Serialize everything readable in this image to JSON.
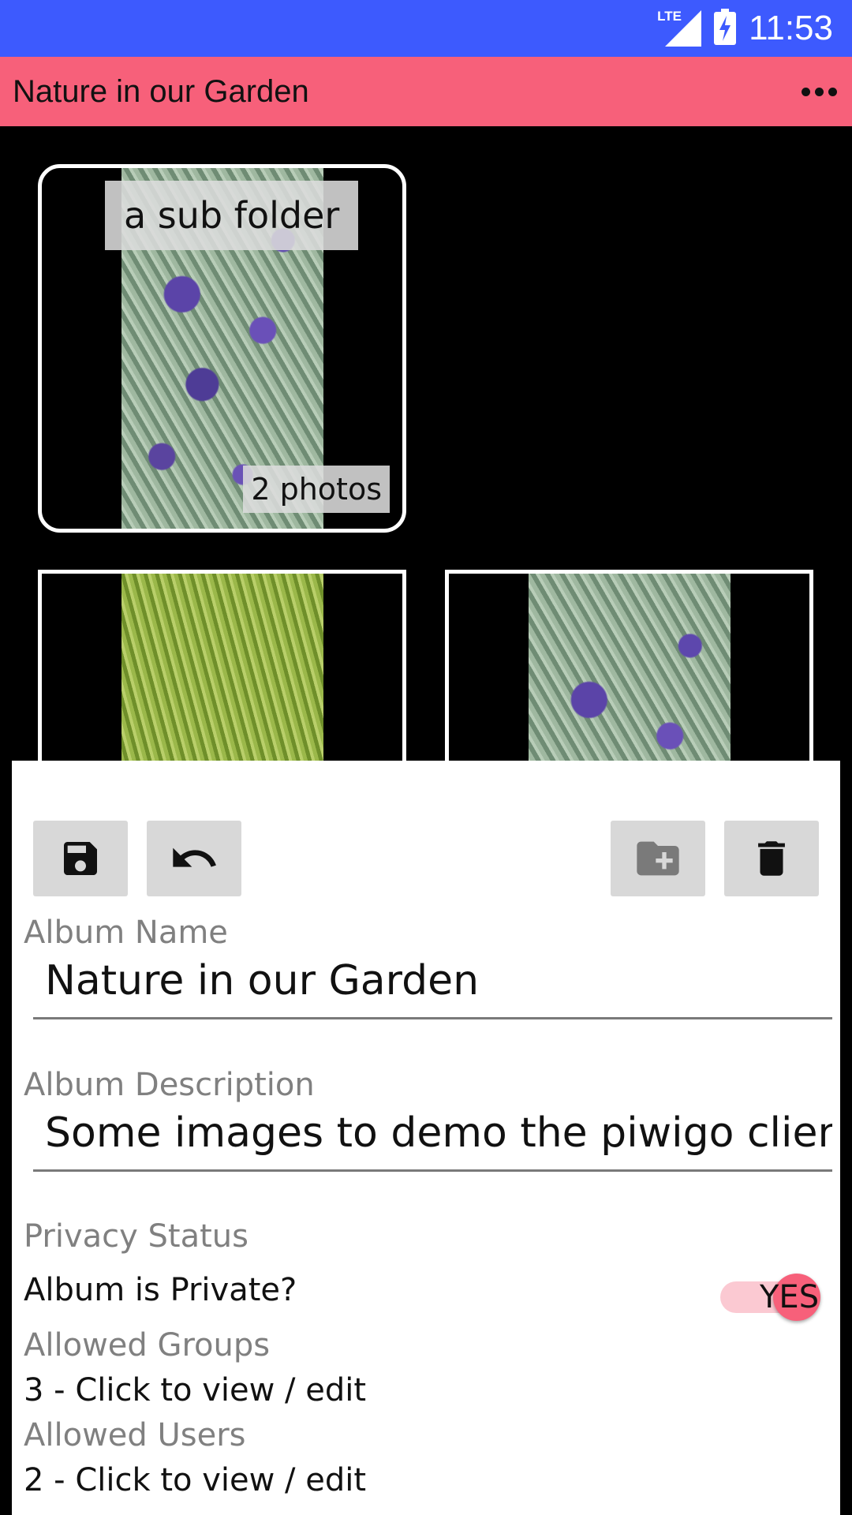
{
  "status_bar": {
    "network": "LTE",
    "time": "11:53",
    "icons": [
      "lte-signal-icon",
      "battery-charging-icon"
    ]
  },
  "toolbar": {
    "title": "Nature in our Garden",
    "overflow_icon": "more-dots-icon"
  },
  "album_grid": {
    "folder": {
      "name": "a sub folder",
      "count": "2 photos"
    },
    "photos": [
      {
        "subject": "grass"
      },
      {
        "subject": "lavender"
      }
    ]
  },
  "editor": {
    "buttons": {
      "save_icon": "save-icon",
      "undo_icon": "undo-icon",
      "add_folder_icon": "create-new-folder-icon",
      "delete_icon": "trash-icon"
    },
    "album_name_label": "Album Name",
    "album_name_value": "Nature in our Garden",
    "album_description_label": "Album Description",
    "album_description_value": "Some images to demo the piwigo client",
    "privacy_label": "Privacy Status",
    "private_question": "Album is Private?",
    "private_switch_text": "YES",
    "private_value": true,
    "allowed_groups_label": "Allowed Groups",
    "allowed_groups_value": "3 - Click to view / edit",
    "allowed_users_label": "Allowed Users",
    "allowed_users_value": "2 - Click to view / edit"
  },
  "colors": {
    "status_bar": "#3D5AFE",
    "toolbar": "#F7607A",
    "switch_thumb": "#F7607A",
    "switch_track": "#FBC9D2",
    "button_bg": "#D8D8D8",
    "label_gray": "#808080"
  }
}
